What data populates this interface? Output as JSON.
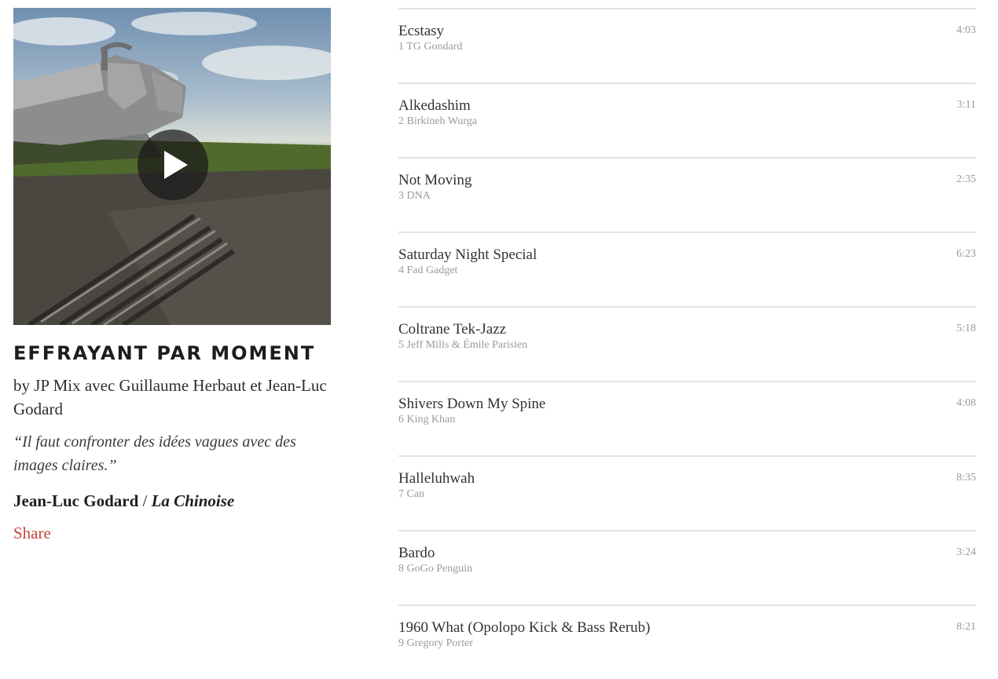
{
  "mix": {
    "title": "EFFRAYANT PAR MOMENT",
    "byline": "by JP Mix avec Guillaume Herbaut et Jean-Luc Godard",
    "quote": "“Il faut confronter des idées vagues avec des images claires.”",
    "quote_author": "Jean-Luc Godard",
    "separator": "/",
    "quote_source": "La Chinoise",
    "share_label": "Share",
    "play_icon": "play-icon",
    "share_color": "#c8443c"
  },
  "tracks": [
    {
      "title": "Ecstasy",
      "number": "1",
      "artist": "TG Gondard",
      "duration": "4:03"
    },
    {
      "title": "Alkedashim",
      "number": "2",
      "artist": "Birkineh Wurga",
      "duration": "3:11"
    },
    {
      "title": "Not Moving",
      "number": "3",
      "artist": "DNA",
      "duration": "2:35"
    },
    {
      "title": "Saturday Night Special",
      "number": "4",
      "artist": "Fad Gadget",
      "duration": "6:23"
    },
    {
      "title": "Coltrane Tek-Jazz",
      "number": "5",
      "artist": "Jeff Mills & Émile Parisien",
      "duration": "5:18"
    },
    {
      "title": "Shivers Down My Spine",
      "number": "6",
      "artist": "King Khan",
      "duration": "4:08"
    },
    {
      "title": "Halleluhwah",
      "number": "7",
      "artist": "Can",
      "duration": "8:35"
    },
    {
      "title": "Bardo",
      "number": "8",
      "artist": "GoGo Penguin",
      "duration": "3:24"
    },
    {
      "title": "1960 What (Opolopo Kick & Bass Rerub)",
      "number": "9",
      "artist": "Gregory Porter",
      "duration": "8:21"
    }
  ]
}
